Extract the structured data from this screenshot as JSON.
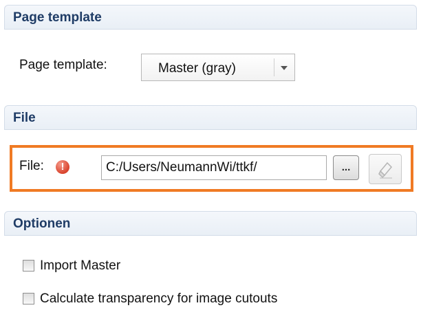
{
  "page_template_section": {
    "header": "Page template",
    "label": "Page template:",
    "select_value": "Master (gray)"
  },
  "file_section": {
    "header": "File",
    "label": "File:",
    "error_icon_glyph": "!",
    "path_value": "C:/Users/NeumannWi/ttkf/",
    "browse_label": "...",
    "clear_icon": "eraser-icon",
    "highlight_color": "#f07a24",
    "error_color": "#d9442e"
  },
  "options_section": {
    "header": "Optionen",
    "options": [
      {
        "label": "Import Master",
        "checked": false
      },
      {
        "label": "Calculate transparency for image cutouts",
        "checked": false
      }
    ]
  },
  "colors": {
    "header_text": "#1f3c66",
    "header_bg": "#e9eff6",
    "header_border": "#d3dce8"
  }
}
